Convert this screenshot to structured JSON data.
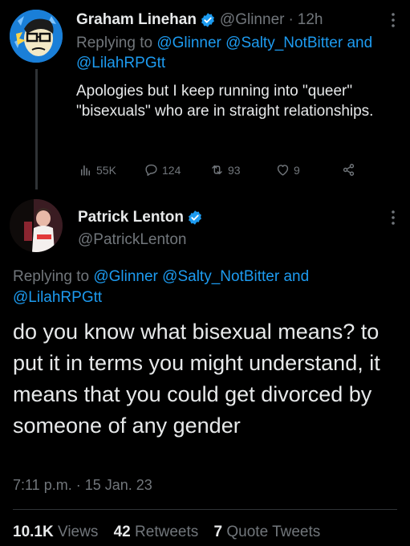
{
  "tweet1": {
    "name": "Graham Linehan",
    "handle": "@Glinner",
    "separator": "·",
    "time": "12h",
    "replying_prefix": "Replying to",
    "replying_to_1": "@Glinner",
    "replying_to_2": "@Salty_NotBitter",
    "replying_and": "and",
    "replying_to_3": "@LilahRPGtt",
    "text": "Apologies but I keep running into \"queer\" \"bisexuals\" who are in straight relationships.",
    "actions": {
      "views": "55K",
      "replies": "124",
      "retweets": "93",
      "likes": "9"
    }
  },
  "tweet2": {
    "name": "Patrick Lenton",
    "handle": "@PatrickLenton",
    "replying_prefix": "Replying to",
    "replying_to_1": "@Glinner",
    "replying_to_2": "@Salty_NotBitter",
    "replying_and": "and",
    "replying_to_3": "@LilahRPGtt",
    "text": "do you know what bisexual means? to put it in terms you might understand, it means that you could get divorced by someone of any gender",
    "time": "7:11 p.m.",
    "separator": "·",
    "date": "15 Jan. 23",
    "stats": {
      "views_count": "10.1K",
      "views_label": "Views",
      "retweets_count": "42",
      "retweets_label": "Retweets",
      "quotes_count": "7",
      "quotes_label": "Quote Tweets"
    }
  },
  "colors": {
    "background": "#000000",
    "text": "#e7e9ea",
    "secondary": "#71767b",
    "link": "#1d9bf0",
    "divider": "#2f3336"
  }
}
